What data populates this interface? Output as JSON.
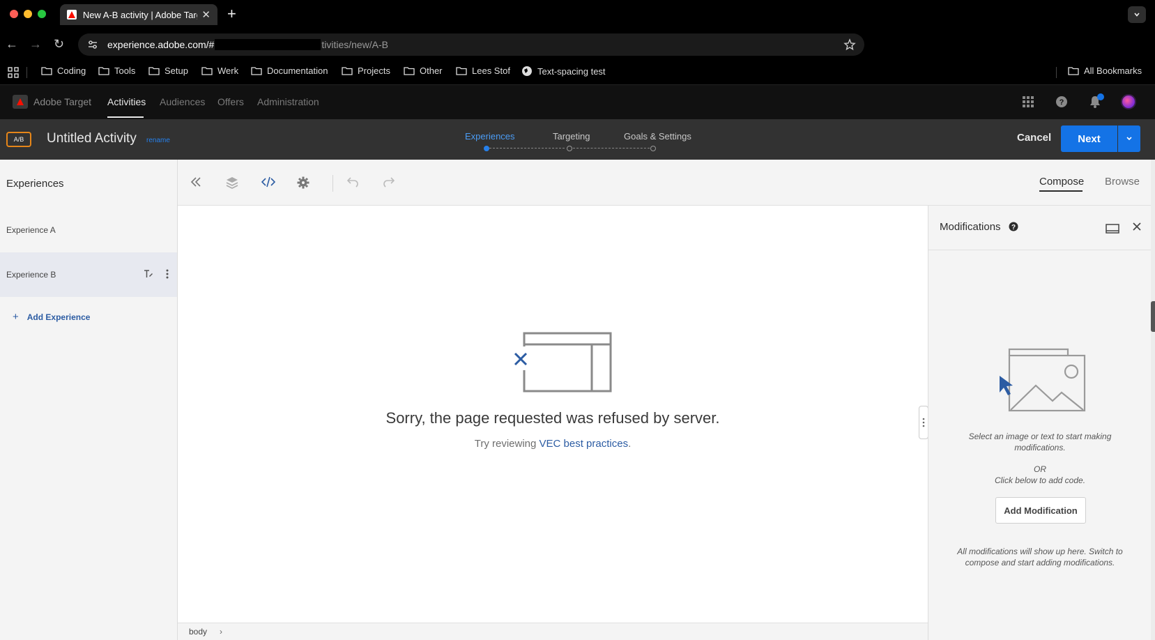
{
  "browser": {
    "tab_title": "New A-B activity | Adobe Targ",
    "new_tab": "+",
    "url_host": "experience.adobe.com/#",
    "url_rest": "tivities/new/A-B",
    "bookmarks": [
      "Coding",
      "Tools",
      "Setup",
      "Werk",
      "Documentation",
      "Projects",
      "Other",
      "Lees Stof",
      "Text-spacing test"
    ],
    "all_bookmarks": "All Bookmarks"
  },
  "app": {
    "name": "Adobe Target",
    "nav": [
      "Activities",
      "Audiences",
      "Offers",
      "Administration"
    ]
  },
  "activity": {
    "badge": "A/B",
    "title": "Untitled Activity",
    "rename": "rename",
    "steps": [
      "Experiences",
      "Targeting",
      "Goals & Settings"
    ],
    "cancel": "Cancel",
    "next": "Next"
  },
  "experiences": {
    "title": "Experiences",
    "items": [
      "Experience A",
      "Experience B"
    ],
    "add": "Add Experience"
  },
  "toolbar": {
    "modes": [
      "Compose",
      "Browse"
    ]
  },
  "canvas": {
    "error_title": "Sorry, the page requested was refused by server.",
    "error_sub_prefix": "Try reviewing ",
    "error_link": "VEC best practices",
    "error_sub_suffix": "."
  },
  "statusbar": {
    "path": "body"
  },
  "modifications": {
    "title": "Modifications",
    "hint": "Select an image or text to start making modifications.",
    "or": "OR",
    "code_hint": "Click below to add code.",
    "add_button": "Add Modification",
    "footer": "All modifications will show up here. Switch to compose and start adding modifications."
  }
}
